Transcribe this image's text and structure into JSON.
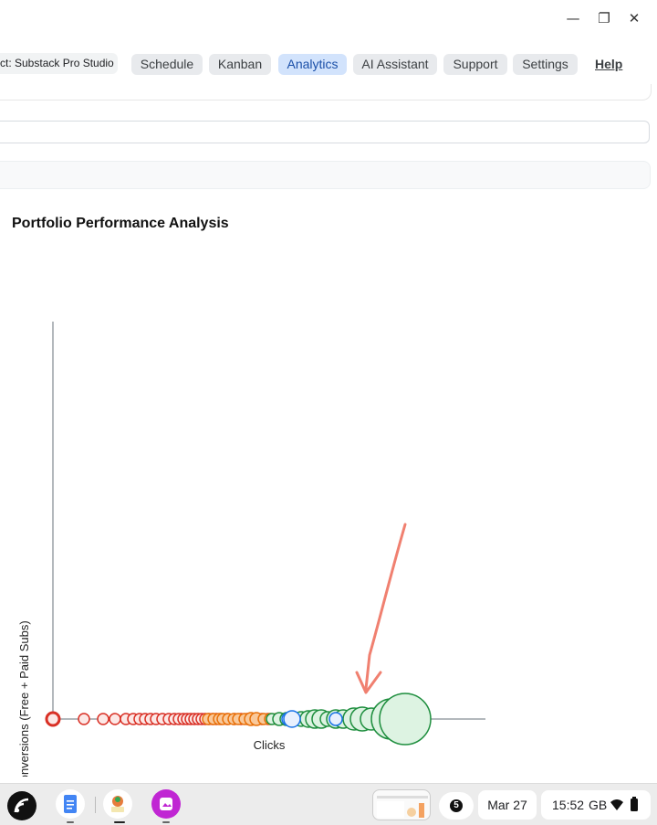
{
  "window": {
    "minimize_glyph": "—",
    "restore_glyph": "❐",
    "close_glyph": "✕"
  },
  "nav": {
    "project_label": "ct: Substack Pro Studio",
    "items": [
      "Schedule",
      "Kanban",
      "Analytics",
      "AI Assistant",
      "Support",
      "Settings"
    ],
    "active_index": 2,
    "help_label": "Help"
  },
  "chart_data": {
    "type": "scatter",
    "title": "Portfolio Performance Analysis",
    "xlabel": "Clicks",
    "ylabel": "Conversions (Free + Paid Subs)",
    "grid": false,
    "legend": "none",
    "series": [
      {
        "color": "#d93025",
        "fill": "#fce8e6",
        "points": [
          [
            0,
            0,
            7
          ],
          [
            34,
            0,
            6
          ],
          [
            55,
            0,
            6
          ],
          [
            68,
            0,
            6
          ],
          [
            80,
            0,
            6
          ],
          [
            88,
            0,
            6
          ],
          [
            95,
            0,
            6
          ],
          [
            101,
            0,
            6
          ],
          [
            107,
            0,
            6
          ],
          [
            113,
            0,
            6
          ],
          [
            120,
            0,
            6
          ],
          [
            127,
            0,
            6
          ],
          [
            133,
            0,
            6
          ],
          [
            138,
            0,
            6
          ],
          [
            143,
            0,
            6
          ],
          [
            147,
            0,
            6
          ],
          [
            151,
            0,
            6
          ],
          [
            155,
            0,
            6
          ],
          [
            159,
            0,
            6
          ],
          [
            163,
            0,
            6
          ],
          [
            167,
            0,
            6
          ],
          [
            171,
            0,
            6
          ],
          [
            175,
            0,
            6
          ],
          [
            179,
            0,
            6
          ],
          [
            184,
            0,
            6
          ],
          [
            191,
            0,
            6
          ],
          [
            199,
            0,
            6
          ],
          [
            206,
            0,
            6
          ],
          [
            213,
            0,
            6
          ],
          [
            221,
            0,
            6
          ],
          [
            229,
            0,
            6
          ],
          [
            236,
            0,
            6
          ]
        ]
      },
      {
        "color": "#e8710a",
        "fill": "#f9c99b",
        "points": [
          [
            170,
            0,
            6
          ],
          [
            176,
            0,
            6
          ],
          [
            182,
            0,
            6
          ],
          [
            186,
            0,
            6
          ],
          [
            192,
            0,
            6
          ],
          [
            198,
            0,
            6
          ],
          [
            203,
            0,
            6
          ],
          [
            210,
            0,
            6
          ],
          [
            217,
            0,
            7
          ],
          [
            223,
            0,
            7
          ],
          [
            231,
            0,
            6
          ],
          [
            238,
            0,
            6
          ],
          [
            245,
            0,
            6
          ]
        ]
      },
      {
        "color": "#1e8e3e",
        "fill": "#ddf3e2",
        "points": [
          [
            240,
            0,
            6
          ],
          [
            248,
            0,
            7
          ],
          [
            256,
            0,
            7
          ],
          [
            264,
            0,
            7
          ],
          [
            272,
            0,
            8
          ],
          [
            280,
            0,
            9
          ],
          [
            287,
            0,
            10
          ],
          [
            294,
            0,
            10
          ],
          [
            301,
            0,
            8
          ],
          [
            310,
            0,
            10
          ],
          [
            318,
            0,
            10
          ],
          [
            330,
            0,
            12
          ],
          [
            339,
            0,
            13
          ],
          [
            349,
            0,
            12
          ],
          [
            368,
            0,
            16
          ],
          [
            371,
            0,
            22
          ],
          [
            386,
            0,
            28
          ]
        ]
      },
      {
        "color": "#1a73e8",
        "fill": "#e8f0fe",
        "points": [
          [
            258,
            0,
            7
          ],
          [
            262,
            0,
            9
          ],
          [
            310,
            0,
            7
          ]
        ]
      }
    ],
    "xlim": [
      0,
      470
    ]
  },
  "taskbar": {
    "notification_count": "5",
    "date": "Mar 27",
    "time": "15:52",
    "locale": "GB"
  }
}
